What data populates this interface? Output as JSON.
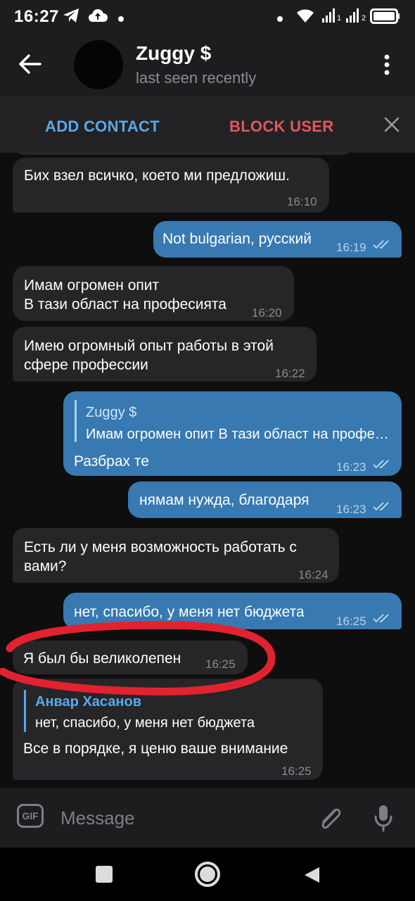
{
  "status_bar": {
    "time": "16:27",
    "icons": [
      "telegram-icon",
      "cloud-upload-icon",
      "dot-icon",
      "dot-icon",
      "wifi-icon",
      "signal-1-icon",
      "signal-2-icon",
      "battery-icon"
    ],
    "sim1": "1",
    "sim2": "2"
  },
  "header": {
    "title": "Zuggy $",
    "subtitle": "last seen recently"
  },
  "action_bar": {
    "add_contact": "ADD CONTACT",
    "block_user": "BLOCK USER"
  },
  "messages": [
    {
      "dir": "in",
      "lines": [
        "Бих взел всичко, което ми предложиш."
      ],
      "time": "16:10"
    },
    {
      "dir": "out",
      "lines": [
        "Not bulgarian, русский"
      ],
      "time": "16:19",
      "read": true
    },
    {
      "dir": "in",
      "lines": [
        "Имам огромен опит",
        "В тази област на професията"
      ],
      "time": "16:20"
    },
    {
      "dir": "in",
      "lines": [
        "Имею огромный опыт работы в этой",
        "сфере профессии"
      ],
      "time": "16:22"
    },
    {
      "dir": "out",
      "reply_to": {
        "name": "Zuggy $",
        "text": "Имам огромен опит В тази област на професията"
      },
      "lines": [
        "Разбрах те"
      ],
      "time": "16:23",
      "read": true
    },
    {
      "dir": "out",
      "lines": [
        "нямам нужда, благодаря"
      ],
      "time": "16:23",
      "read": true
    },
    {
      "dir": "in",
      "lines": [
        "Есть ли у меня возможность работать с",
        "вами?"
      ],
      "time": "16:24"
    },
    {
      "dir": "out",
      "lines": [
        "нет, спасибо, у меня нет бюджета"
      ],
      "time": "16:25",
      "read": true
    },
    {
      "dir": "in",
      "lines": [
        "Я был бы великолепен"
      ],
      "time": "16:25"
    },
    {
      "dir": "in",
      "reply_to": {
        "name": "Анвар Хасанов",
        "text": "нет, спасибо, у меня нет бюджета"
      },
      "lines": [
        "Все в порядке, я ценю ваше внимание"
      ],
      "time": "16:25"
    }
  ],
  "input": {
    "gif_label": "GIF",
    "placeholder": "Message"
  },
  "colors": {
    "background": "#0e0e0e",
    "bar": "#1d1d1f",
    "incoming_bubble": "#262628",
    "outgoing_bubble": "#3779b0",
    "accent_blue": "#5aa9e8",
    "danger_red": "#e2575d",
    "annotation_red": "#e3222f",
    "timestamp_grey": "#8b8b8e"
  }
}
